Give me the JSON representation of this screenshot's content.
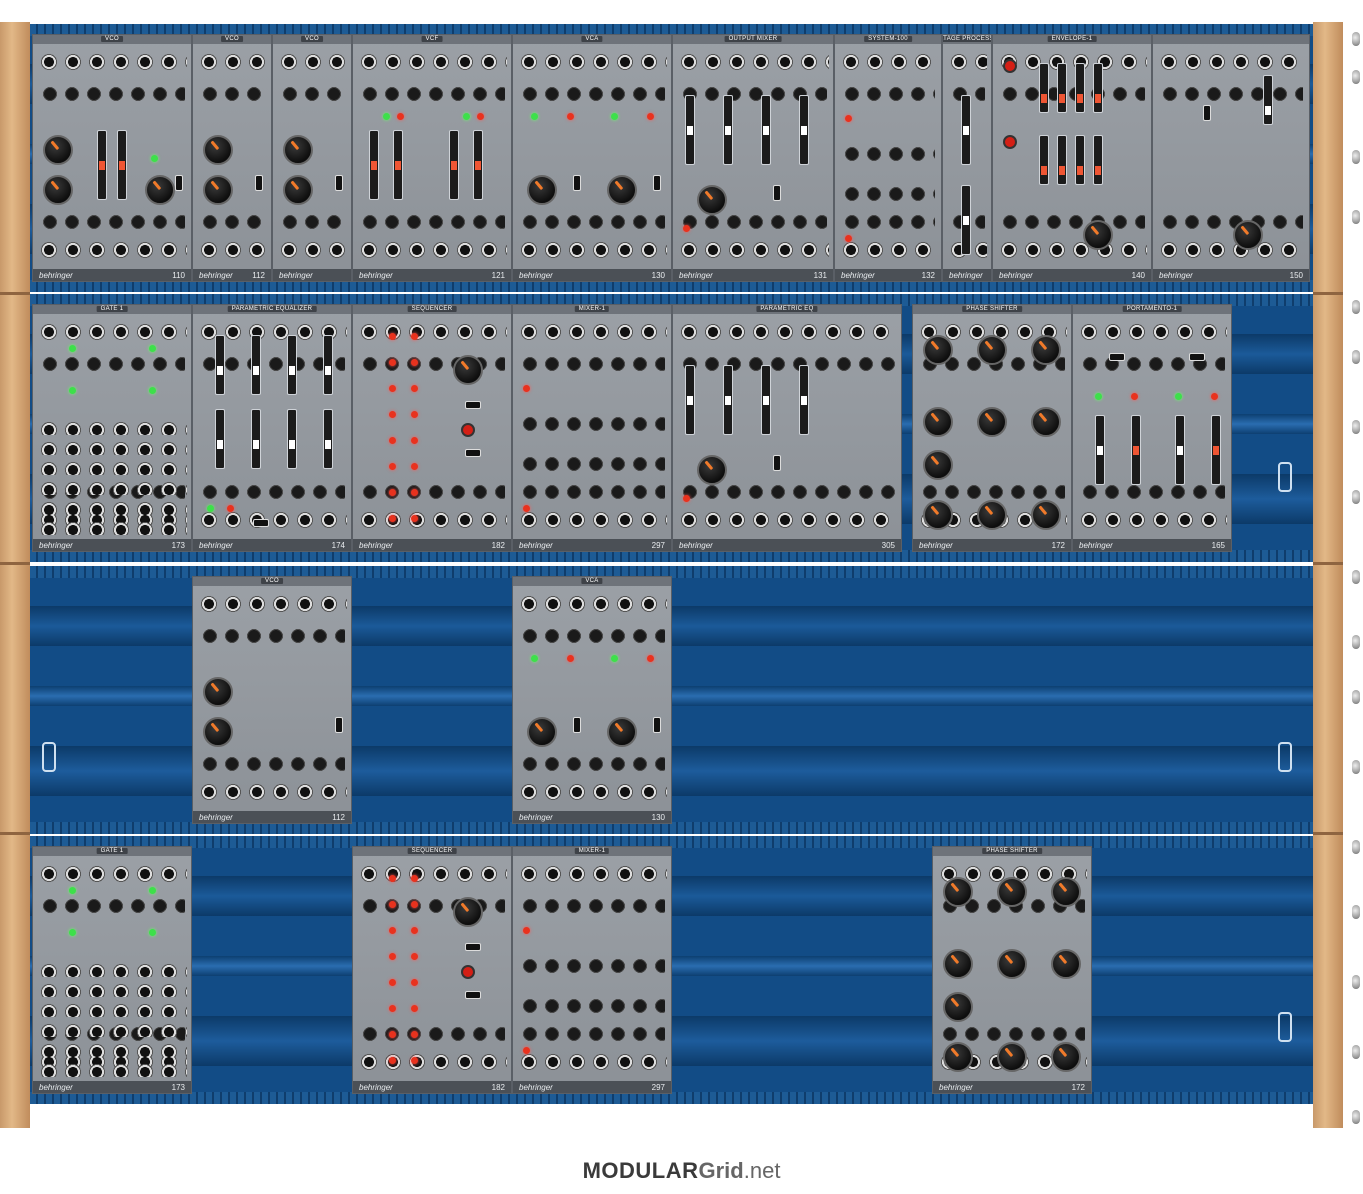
{
  "brand": "behringer",
  "footer": {
    "logo_part1": "MODULAR",
    "logo_part2": "Grid",
    "logo_part3": ".net"
  },
  "rows": [
    {
      "modules": [
        {
          "title": "VCO",
          "number": "110",
          "kind": "vco110"
        },
        {
          "title": "VCO",
          "number": "112",
          "kind": "vco"
        },
        {
          "title": "VCO",
          "number": "",
          "kind": "vco"
        },
        {
          "title": "VCF",
          "number": "121",
          "kind": "vcf"
        },
        {
          "title": "VCA",
          "number": "130",
          "kind": "vca"
        },
        {
          "title": "OUTPUT MIXER",
          "number": "131",
          "kind": "outmix"
        },
        {
          "title": "SYSTEM-100",
          "number": "132",
          "kind": "mixer"
        },
        {
          "title": "VOLTAGE PROCESSOR",
          "number": "",
          "kind": "vp"
        },
        {
          "title": "ENVELOPE-1",
          "number": "140",
          "kind": "env"
        },
        {
          "title": "",
          "number": "150",
          "kind": "noise"
        }
      ]
    },
    {
      "modules": [
        {
          "title": "GATE 1",
          "number": "173",
          "kind": "gate"
        },
        {
          "title": "PARAMETRIC EQUALIZER",
          "number": "174",
          "kind": "eq"
        },
        {
          "title": "SEQUENCER",
          "number": "182",
          "kind": "seq"
        },
        {
          "title": "MIXER-1",
          "number": "297",
          "kind": "dualmix"
        },
        {
          "title": "PARAMETRIC EQ",
          "number": "305",
          "kind": "outmix2"
        },
        {
          "title": "PHASE SHIFTER",
          "number": "172",
          "kind": "phase"
        },
        {
          "title": "PORTAMENTO-1",
          "number": "165",
          "kind": "porta"
        }
      ]
    },
    {
      "modules": [
        {
          "title": "VCO",
          "number": "112",
          "kind": "vco"
        },
        {
          "title": "VCA",
          "number": "130",
          "kind": "vca"
        }
      ]
    },
    {
      "modules": [
        {
          "title": "GATE 1",
          "number": "173",
          "kind": "gate"
        },
        {
          "title": "SEQUENCER",
          "number": "182",
          "kind": "seq"
        },
        {
          "title": "MIXER-1",
          "number": "297",
          "kind": "dualmix"
        },
        {
          "title": "PHASE SHIFTER",
          "number": "172",
          "kind": "phase"
        }
      ]
    }
  ]
}
